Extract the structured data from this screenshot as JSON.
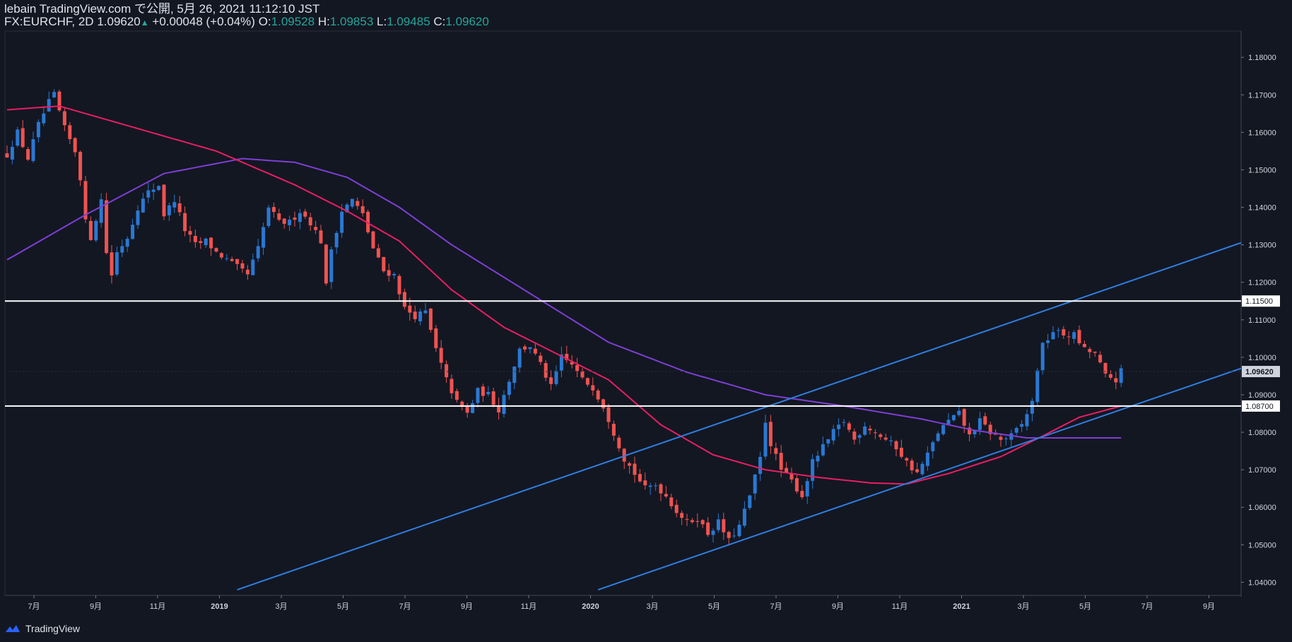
{
  "header": {
    "line1": "lebain TradingView.com で公開, 5月 26, 2021 11:12:10 JST",
    "symbol": "FX:EURCHF, 2D",
    "last": "1.09620",
    "change": "+0.00048 (+0.04%)",
    "o_label": "O:",
    "o_value": "1.09528",
    "h_label": "H:",
    "h_value": "1.09853",
    "l_label": "L:",
    "l_value": "1.09485",
    "c_label": "C:",
    "c_value": "1.09620"
  },
  "footer": {
    "brand": "TradingView",
    "logo_icon": "tradingview-logo-icon"
  },
  "colors": {
    "background": "#131722",
    "up": "#2a78d2",
    "down": "#ef5350",
    "ma_short": "#e91e63",
    "ma_long": "#7e3fd6",
    "trendline": "#2f7ee0",
    "level": "#ffffff"
  },
  "chart_data": {
    "type": "candlestick",
    "price_ticks": [
      "1.18000",
      "1.17000",
      "1.16000",
      "1.15000",
      "1.14000",
      "1.13000",
      "1.12000",
      "1.11000",
      "1.10000",
      "1.09000",
      "1.08000",
      "1.07000",
      "1.06000",
      "1.05000",
      "1.04000"
    ],
    "time_ticks": [
      "7月",
      "9月",
      "11月",
      "2019",
      "3月",
      "5月",
      "7月",
      "9月",
      "11月",
      "2020",
      "3月",
      "5月",
      "7月",
      "9月",
      "11月",
      "2021",
      "3月",
      "5月",
      "7月",
      "9月"
    ],
    "bold_time_ticks": [
      "2019",
      "2020",
      "2021"
    ],
    "y_range": [
      1.0365,
      1.187
    ],
    "levels": [
      {
        "price": 1.115,
        "label": "1.11500"
      },
      {
        "price": 1.087,
        "label": "1.08700"
      }
    ],
    "last_price": {
      "price": 1.0962,
      "label": "1.09620"
    },
    "close_path": [
      [
        0,
        1.154
      ],
      [
        2,
        1.16
      ],
      [
        4,
        1.153
      ],
      [
        6,
        1.162
      ],
      [
        8,
        1.168
      ],
      [
        9,
        1.17
      ],
      [
        11,
        1.161
      ],
      [
        13,
        1.155
      ],
      [
        14,
        1.148
      ],
      [
        15,
        1.136
      ],
      [
        16,
        1.132
      ],
      [
        18,
        1.142
      ],
      [
        19,
        1.128
      ],
      [
        20,
        1.122
      ],
      [
        21,
        1.128
      ],
      [
        23,
        1.132
      ],
      [
        25,
        1.14
      ],
      [
        27,
        1.144
      ],
      [
        29,
        1.146
      ],
      [
        30,
        1.138
      ],
      [
        32,
        1.142
      ],
      [
        34,
        1.134
      ],
      [
        36,
        1.13
      ],
      [
        38,
        1.131
      ],
      [
        40,
        1.128
      ],
      [
        42,
        1.126
      ],
      [
        44,
        1.124
      ],
      [
        46,
        1.122
      ],
      [
        48,
        1.129
      ],
      [
        50,
        1.14
      ],
      [
        52,
        1.136
      ],
      [
        54,
        1.136
      ],
      [
        56,
        1.139
      ],
      [
        58,
        1.136
      ],
      [
        60,
        1.131
      ],
      [
        61,
        1.119
      ],
      [
        62,
        1.129
      ],
      [
        64,
        1.139
      ],
      [
        66,
        1.142
      ],
      [
        68,
        1.138
      ],
      [
        70,
        1.129
      ],
      [
        72,
        1.123
      ],
      [
        74,
        1.122
      ],
      [
        76,
        1.113
      ],
      [
        78,
        1.111
      ],
      [
        80,
        1.112
      ],
      [
        82,
        1.102
      ],
      [
        84,
        1.094
      ],
      [
        86,
        1.088
      ],
      [
        88,
        1.085
      ],
      [
        90,
        1.091
      ],
      [
        92,
        1.09
      ],
      [
        94,
        1.086
      ],
      [
        96,
        1.094
      ],
      [
        98,
        1.102
      ],
      [
        100,
        1.103
      ],
      [
        102,
        1.098
      ],
      [
        104,
        1.092
      ],
      [
        106,
        1.1
      ],
      [
        108,
        1.098
      ],
      [
        110,
        1.094
      ],
      [
        112,
        1.092
      ],
      [
        114,
        1.087
      ],
      [
        116,
        1.08
      ],
      [
        118,
        1.073
      ],
      [
        120,
        1.069
      ],
      [
        122,
        1.065
      ],
      [
        124,
        1.066
      ],
      [
        126,
        1.063
      ],
      [
        128,
        1.059
      ],
      [
        130,
        1.056
      ],
      [
        132,
        1.057
      ],
      [
        134,
        1.053
      ],
      [
        136,
        1.056
      ],
      [
        138,
        1.051
      ],
      [
        140,
        1.055
      ],
      [
        142,
        1.063
      ],
      [
        144,
        1.073
      ],
      [
        145,
        1.083
      ],
      [
        146,
        1.077
      ],
      [
        148,
        1.07
      ],
      [
        150,
        1.067
      ],
      [
        152,
        1.063
      ],
      [
        154,
        1.072
      ],
      [
        156,
        1.076
      ],
      [
        158,
        1.08
      ],
      [
        160,
        1.083
      ],
      [
        162,
        1.078
      ],
      [
        164,
        1.082
      ],
      [
        166,
        1.08
      ],
      [
        168,
        1.078
      ],
      [
        170,
        1.076
      ],
      [
        172,
        1.072
      ],
      [
        174,
        1.069
      ],
      [
        176,
        1.074
      ],
      [
        178,
        1.08
      ],
      [
        180,
        1.083
      ],
      [
        182,
        1.085
      ],
      [
        184,
        1.079
      ],
      [
        186,
        1.083
      ],
      [
        188,
        1.08
      ],
      [
        190,
        1.078
      ],
      [
        192,
        1.079
      ],
      [
        194,
        1.082
      ],
      [
        196,
        1.088
      ],
      [
        197,
        1.097
      ],
      [
        198,
        1.103
      ],
      [
        200,
        1.107
      ],
      [
        202,
        1.106
      ],
      [
        204,
        1.106
      ],
      [
        206,
        1.102
      ],
      [
        208,
        1.101
      ],
      [
        210,
        1.095
      ],
      [
        212,
        1.094
      ],
      [
        213,
        1.0962
      ]
    ],
    "ma_short": [
      [
        0,
        1.166
      ],
      [
        10,
        1.167
      ],
      [
        25,
        1.161
      ],
      [
        40,
        1.155
      ],
      [
        55,
        1.146
      ],
      [
        65,
        1.139
      ],
      [
        75,
        1.131
      ],
      [
        85,
        1.118
      ],
      [
        95,
        1.108
      ],
      [
        105,
        1.101
      ],
      [
        115,
        1.094
      ],
      [
        125,
        1.082
      ],
      [
        135,
        1.074
      ],
      [
        145,
        1.07
      ],
      [
        155,
        1.068
      ],
      [
        165,
        1.0665
      ],
      [
        172,
        1.0662
      ],
      [
        180,
        1.069
      ],
      [
        190,
        1.0735
      ],
      [
        198,
        1.079
      ],
      [
        205,
        1.084
      ],
      [
        213,
        1.087
      ]
    ],
    "ma_long": [
      [
        0,
        1.126
      ],
      [
        15,
        1.138
      ],
      [
        30,
        1.149
      ],
      [
        45,
        1.153
      ],
      [
        55,
        1.152
      ],
      [
        65,
        1.148
      ],
      [
        75,
        1.14
      ],
      [
        85,
        1.13
      ],
      [
        100,
        1.117
      ],
      [
        115,
        1.104
      ],
      [
        130,
        1.096
      ],
      [
        145,
        1.09
      ],
      [
        160,
        1.087
      ],
      [
        175,
        1.0835
      ],
      [
        185,
        1.0805
      ],
      [
        195,
        1.0785
      ],
      [
        205,
        1.0785
      ],
      [
        213,
        1.0785
      ]
    ],
    "trendlines": [
      {
        "from": [
          44,
          1.038
        ],
        "to": [
          240,
          1.1325
        ]
      },
      {
        "from": [
          113,
          1.038
        ],
        "to": [
          240,
          1.099
        ]
      }
    ]
  }
}
